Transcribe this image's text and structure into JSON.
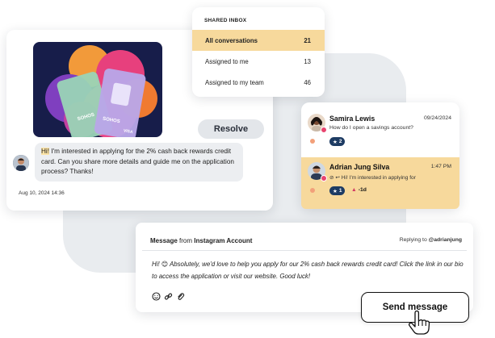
{
  "conversation": {
    "resolve_label": "Resolve",
    "message_highlight": "Hi!",
    "message_text": " I'm interested in applying for the 2% cash back rewards credit card. Can you share more details and guide me on the application process? Thanks!",
    "timestamp": "Aug 10, 2024 14:36",
    "card_brand": "SOHOS",
    "card_brand_2": "SOHOS",
    "card_tag": "VISA"
  },
  "inbox": {
    "title": "SHARED INBOX",
    "rows": [
      {
        "label": "All conversations",
        "count": "21"
      },
      {
        "label": "Assigned to me",
        "count": "13"
      },
      {
        "label": "Assigned to my team",
        "count": "46"
      }
    ]
  },
  "contacts": [
    {
      "name": "Samira Lewis",
      "date": "09/24/2024",
      "preview": "How do I open a savings account?",
      "tag": "2"
    },
    {
      "name": "Adrian Jung Silva",
      "date": "1:47 PM",
      "preview": "Hi! I'm interested in applying for",
      "tag": "1",
      "due": "-1d"
    }
  ],
  "composer": {
    "label_prefix": "Message",
    "label_from": "from",
    "account": "Instagram Account",
    "reply_prefix": "Replying to",
    "reply_handle": "@adrianjung",
    "text": "Hi! 😊 Absolutely, we'd love to help you apply for our 2% cash back rewards credit card! Click the link in our bio to access the application or visit our website. Good luck!",
    "send_label": "Send message"
  },
  "colors": {
    "highlight": "#f7d99c",
    "tag": "#1d3b63",
    "badge": "#e8446f"
  }
}
